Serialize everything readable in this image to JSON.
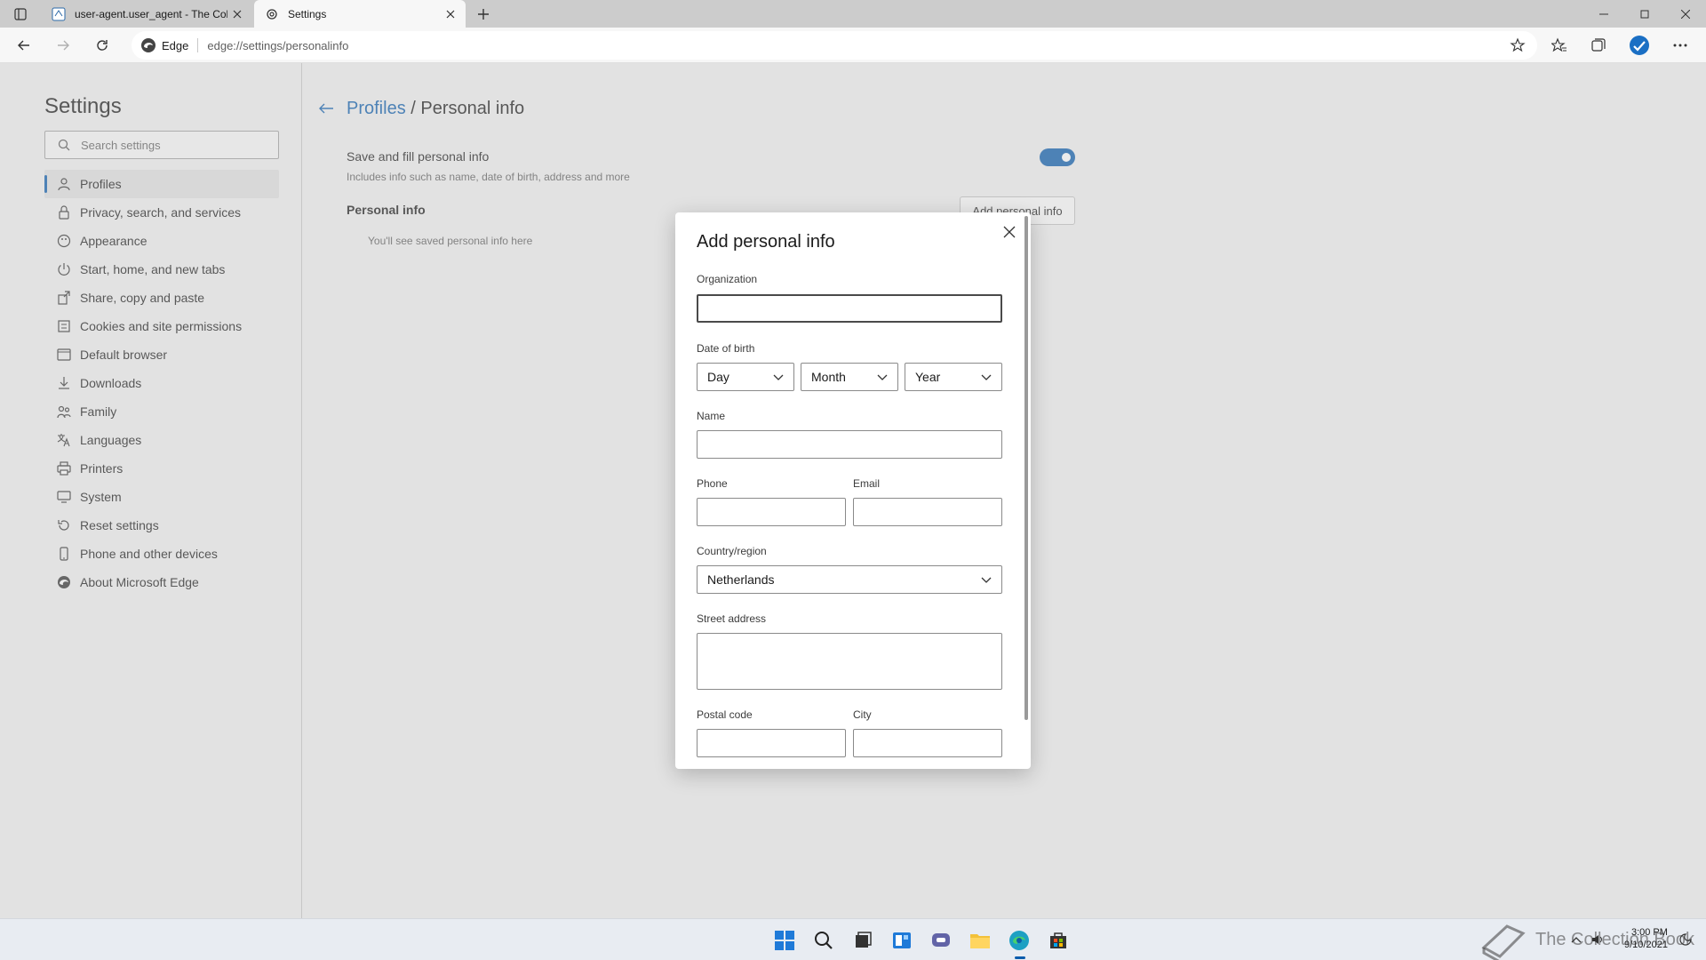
{
  "browser": {
    "tabs": [
      {
        "title": "user-agent.user_agent - The Col",
        "active": false
      },
      {
        "title": "Settings",
        "active": true
      }
    ],
    "address": {
      "site_label": "Edge",
      "url": "edge://settings/personalinfo"
    }
  },
  "sidebar": {
    "title": "Settings",
    "search_placeholder": "Search settings",
    "items": [
      {
        "label": "Profiles",
        "icon": "profile-icon",
        "selected": true
      },
      {
        "label": "Privacy, search, and services",
        "icon": "lock-icon"
      },
      {
        "label": "Appearance",
        "icon": "appearance-icon"
      },
      {
        "label": "Start, home, and new tabs",
        "icon": "power-icon"
      },
      {
        "label": "Share, copy and paste",
        "icon": "share-icon"
      },
      {
        "label": "Cookies and site permissions",
        "icon": "permissions-icon"
      },
      {
        "label": "Default browser",
        "icon": "browser-icon"
      },
      {
        "label": "Downloads",
        "icon": "download-icon"
      },
      {
        "label": "Family",
        "icon": "family-icon"
      },
      {
        "label": "Languages",
        "icon": "language-icon"
      },
      {
        "label": "Printers",
        "icon": "printer-icon"
      },
      {
        "label": "System",
        "icon": "system-icon"
      },
      {
        "label": "Reset settings",
        "icon": "reset-icon"
      },
      {
        "label": "Phone and other devices",
        "icon": "phone-icon"
      },
      {
        "label": "About Microsoft Edge",
        "icon": "edge-icon"
      }
    ]
  },
  "main": {
    "breadcrumb": {
      "parent": "Profiles",
      "separator": "/",
      "current": "Personal info"
    },
    "save_fill": {
      "title": "Save and fill personal info",
      "subtitle": "Includes info such as name, date of birth, address and more",
      "enabled": true
    },
    "section_title": "Personal info",
    "add_button": "Add personal info",
    "empty_note": "You'll see saved personal info here"
  },
  "dialog": {
    "title": "Add personal info",
    "organization_label": "Organization",
    "organization_value": "",
    "dob_label": "Date of birth",
    "day": "Day",
    "month": "Month",
    "year": "Year",
    "name_label": "Name",
    "phone_label": "Phone",
    "email_label": "Email",
    "country_label": "Country/region",
    "country_value": "Netherlands",
    "street_label": "Street address",
    "postal_label": "Postal code",
    "city_label": "City"
  },
  "taskbar": {
    "time": "3:00 PM",
    "date": "9/10/2021",
    "watermark": "The Collection Book"
  },
  "colors": {
    "accent": "#0b5cad",
    "page_bg": "#f0f0f0"
  }
}
